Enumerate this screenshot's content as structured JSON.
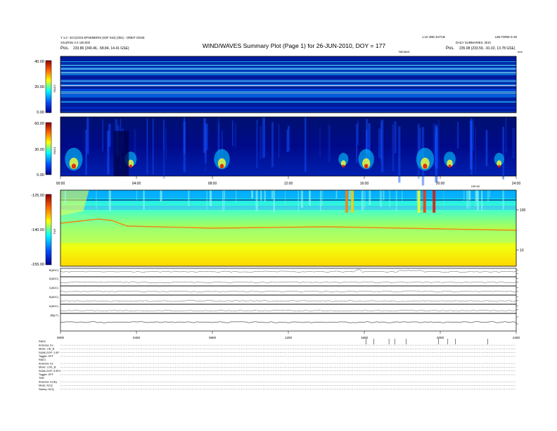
{
  "header": {
    "title": "WIND/WAVES Summary Plot (Page 1) for 26-JUN-2010, DOY = 177",
    "left_line1": "Y 1.0 - ECC|OG3 EPHEMERIS (KSF 010) (Obs) - ORBIT OGSE",
    "left_line2": "XSL(RSN 3 X 100.000",
    "left_pos_label": "Pos.",
    "left_pos_value": "233.86 (249.46, -58.84, 14.41 GSE)",
    "right_line1": "1.10 VBD 2UTCB",
    "right_line2": "L2B FORM m 60",
    "right_line3": "DAILY SUMMARIES, 2010",
    "right_pos_label": "Pos.",
    "right_pos_value": "235.08 (233.59, -91.02, 13.78 GSE)",
    "tc_label": "TBE/BKE",
    "tc_right": "kHz"
  },
  "colors": {
    "background": "#000e8a",
    "grid": "#ffffff"
  },
  "chart_data": [
    {
      "type": "heatmap",
      "panel": "RAD2",
      "ylabel": "RAD2",
      "yticks": [
        "40.00",
        "20.00",
        "0.00"
      ],
      "ylim": [
        0,
        40
      ]
    },
    {
      "type": "heatmap",
      "panel": "RAD1",
      "ylabel": "RAD1",
      "yticks": [
        "60.00",
        "30.00",
        "0.00"
      ],
      "ylim": [
        0,
        60
      ],
      "xticks": [
        "00:00",
        "04:00",
        "08:00",
        "12:00",
        "16:00",
        "20:00",
        "24:00"
      ],
      "xtick_note": "DRY00"
    },
    {
      "type": "heatmap",
      "panel": "TNR",
      "ylabel": "TNR",
      "yticks": [
        "-125.00",
        "-140.00",
        "-155.00"
      ],
      "ylim": [
        -155,
        -125
      ],
      "right_ticks": [
        "100",
        "10"
      ]
    },
    {
      "type": "line",
      "panel": "OMNI",
      "series": [
        {
          "name": "B(ADC)",
          "level": 0.6
        },
        {
          "name": "D(ADC)",
          "level": 0.4
        },
        {
          "name": "C(ADC)",
          "level": 0.4
        },
        {
          "name": "B(ADC)",
          "level": 0.35
        },
        {
          "name": "A(ADC)",
          "level": 0.3
        },
        {
          "name": "|B|(nT)",
          "level": 0.5
        }
      ],
      "xticks": [
        "0000",
        "0400",
        "0800",
        "1200",
        "1600",
        "2000",
        "2400"
      ]
    }
  ],
  "status": {
    "rad2": [
      "RAD2",
      "Antenna: Ex",
      "Mode: LIN_B",
      "SUMLOOP: 1.5P",
      "Toggle: OFF"
    ],
    "rad1": [
      "RAD1",
      "Antenna: Ex",
      "Mode: LOG_B",
      "SUMLOOP: 5.5Px",
      "Toggle: OFF"
    ],
    "tnr": [
      "TNR",
      "Antenna: Ex/Ey",
      "Mode: ACQ",
      "Sweep: ACQ"
    ]
  }
}
